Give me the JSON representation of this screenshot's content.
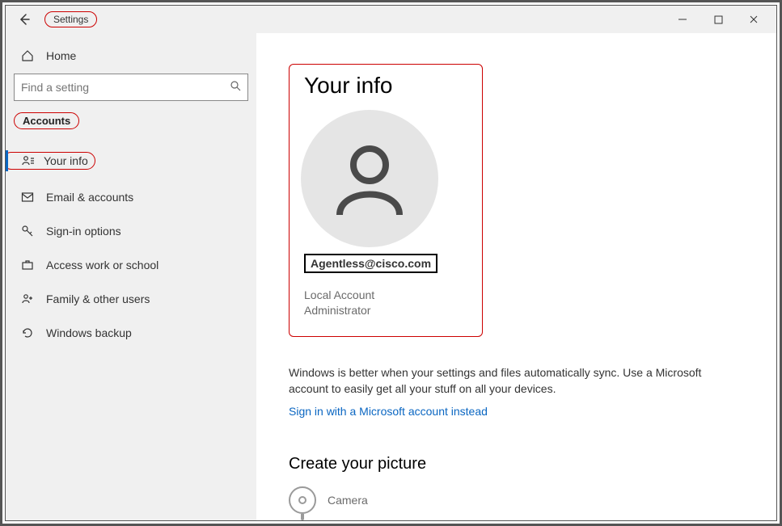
{
  "window": {
    "title": "Settings"
  },
  "sidebar": {
    "home_label": "Home",
    "search_placeholder": "Find a setting",
    "section_label": "Accounts",
    "items": [
      {
        "label": "Your info"
      },
      {
        "label": "Email & accounts"
      },
      {
        "label": "Sign-in options"
      },
      {
        "label": "Access work or school"
      },
      {
        "label": "Family & other users"
      },
      {
        "label": "Windows backup"
      }
    ]
  },
  "main": {
    "heading": "Your info",
    "email": "Agentless@cisco.com",
    "account_type_line1": "Local Account",
    "account_type_line2": "Administrator",
    "body_text": "Windows is better when your settings and files automatically sync. Use a Microsoft account to easily get all your stuff on all your devices.",
    "link_text": "Sign in with a Microsoft account instead",
    "picture_heading": "Create your picture",
    "camera_label": "Camera"
  }
}
